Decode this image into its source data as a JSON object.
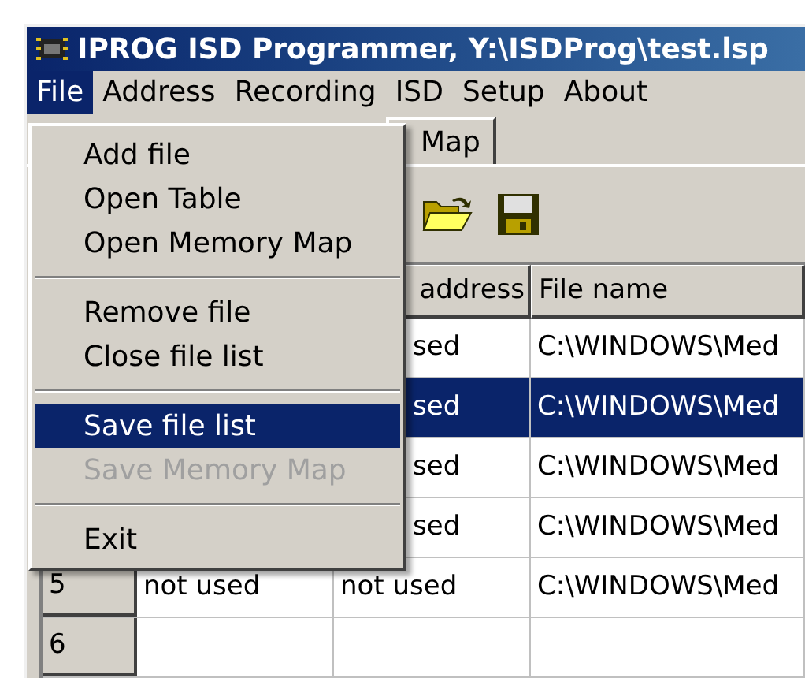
{
  "window": {
    "title": "IPROG ISD Programmer, Y:\\ISDProg\\test.lsp"
  },
  "menu_bar": [
    {
      "label": "File",
      "selected": true
    },
    {
      "label": "Address",
      "selected": false
    },
    {
      "label": "Recording",
      "selected": false
    },
    {
      "label": "ISD",
      "selected": false
    },
    {
      "label": "Setup",
      "selected": false
    },
    {
      "label": "About",
      "selected": false
    }
  ],
  "file_menu": [
    {
      "kind": "item",
      "label": "Add file",
      "selected": false,
      "disabled": false
    },
    {
      "kind": "item",
      "label": "Open Table",
      "selected": false,
      "disabled": false
    },
    {
      "kind": "item",
      "label": "Open Memory Map",
      "selected": false,
      "disabled": false
    },
    {
      "kind": "separator"
    },
    {
      "kind": "item",
      "label": "Remove file",
      "selected": false,
      "disabled": false
    },
    {
      "kind": "item",
      "label": "Close file list",
      "selected": false,
      "disabled": false
    },
    {
      "kind": "separator"
    },
    {
      "kind": "item",
      "label": "Save file list",
      "selected": true,
      "disabled": false
    },
    {
      "kind": "item",
      "label": "Save Memory Map",
      "selected": false,
      "disabled": true
    },
    {
      "kind": "separator"
    },
    {
      "kind": "item",
      "label": "Exit",
      "selected": false,
      "disabled": false
    }
  ],
  "tab": {
    "label": "Map"
  },
  "table": {
    "columns": [
      "address",
      "File name"
    ],
    "rows": [
      {
        "column_2": "sed",
        "file_name": "C:\\WINDOWS\\Med",
        "selected": false
      },
      {
        "column_2": "sed",
        "file_name": "C:\\WINDOWS\\Med",
        "selected": true
      },
      {
        "column_2": "sed",
        "file_name": "C:\\WINDOWS\\Med",
        "selected": false
      },
      {
        "column_2": "sed",
        "file_name": "C:\\WINDOWS\\Med",
        "selected": false
      },
      {
        "row_header": "5",
        "column_1": "not used",
        "column_2": "not used",
        "file_name": "C:\\WINDOWS\\Med",
        "selected": false
      },
      {
        "row_header": "6",
        "selected": false
      }
    ]
  }
}
